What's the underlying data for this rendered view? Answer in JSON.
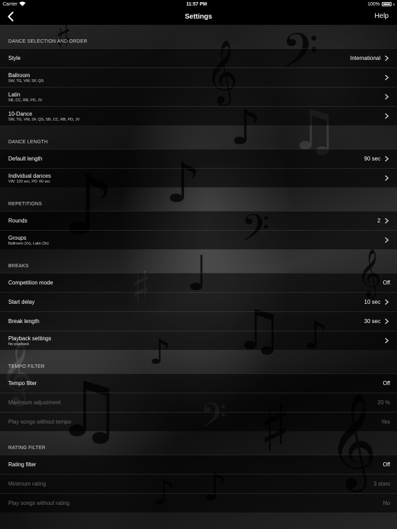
{
  "status_bar": {
    "carrier": "Carrier",
    "time": "11:57 PM",
    "battery": "100%"
  },
  "nav": {
    "title": "Settings",
    "help_label": "Help"
  },
  "sections": {
    "dance_selection": {
      "header": "DANCE SELECTION AND ORDER",
      "style": {
        "label": "Style",
        "value": "International"
      },
      "ballroom": {
        "label": "Ballroom",
        "sub": "SW, TG, VW, SF, QS"
      },
      "latin": {
        "label": "Latin",
        "sub": "SB, CC, RB, PD, JV"
      },
      "ten_dance": {
        "label": "10-Dance",
        "sub": "SW, TG, VW, SF, QS, SB, CC, RB, PD, JV"
      }
    },
    "dance_length": {
      "header": "DANCE LENGTH",
      "default_length": {
        "label": "Default length",
        "value": "90 sec"
      },
      "individual": {
        "label": "Individual dances",
        "sub": "VW: 120 sec, PD: 60 sec"
      }
    },
    "repetitions": {
      "header": "REPETITIONS",
      "rounds": {
        "label": "Rounds",
        "value": "2"
      },
      "groups": {
        "label": "Groups",
        "sub": "Ballroom (2x), Latin (3x)"
      }
    },
    "breaks": {
      "header": "BREAKS",
      "competition": {
        "label": "Competition mode",
        "value": "Off"
      },
      "start_delay": {
        "label": "Start delay",
        "value": "10 sec"
      },
      "break_length": {
        "label": "Break length",
        "value": "30 sec"
      },
      "playback": {
        "label": "Playback settings",
        "sub": "No playback"
      }
    },
    "tempo_filter": {
      "header": "TEMPO FILTER",
      "tempo": {
        "label": "Tempo filter",
        "value": "Off"
      },
      "max_adjust": {
        "label": "Maximum adjustment",
        "value": "20 %"
      },
      "without_tempo": {
        "label": "Play songs without tempo",
        "value": "Yes"
      }
    },
    "rating_filter": {
      "header": "RATING FILTER",
      "rating": {
        "label": "Rating filter",
        "value": "Off"
      },
      "min_rating": {
        "label": "Minimum rating",
        "value": "3 stars"
      },
      "without_rating": {
        "label": "Play songs without rating",
        "value": "No"
      }
    }
  }
}
